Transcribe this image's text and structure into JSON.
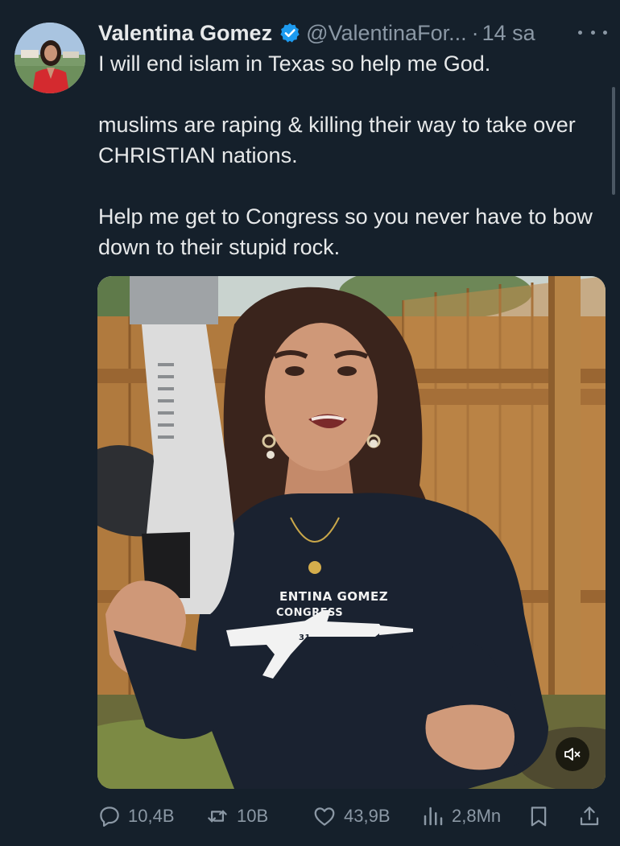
{
  "tweet": {
    "author": {
      "display_name": "Valentina Gomez",
      "handle": "@ValentinaFor...",
      "verified": true
    },
    "separator": "·",
    "timestamp": "14 sa",
    "text": {
      "line1": "I will end islam in Texas so help me God.",
      "paragraph2": "muslims are raping & killing their way to take over CHRISTIAN nations.",
      "paragraph3": "Help me get to Congress so you never have to bow down to their stupid rock."
    },
    "media": {
      "type": "video",
      "shirt_line1": "ENTINA GOMEZ",
      "shirt_line2": "CONGRESS",
      "shirt_number": "31",
      "muted": true
    },
    "stats": {
      "replies": "10,4B",
      "reposts": "10B",
      "likes": "43,9B",
      "views": "2,8Mn"
    }
  },
  "icons": {
    "more": "more-horizontal-icon",
    "verified": "verified-badge-icon",
    "reply": "reply-icon",
    "repost": "repost-icon",
    "like": "heart-icon",
    "views": "views-chart-icon",
    "bookmark": "bookmark-icon",
    "share": "share-icon",
    "mute": "volume-muted-icon"
  },
  "colors": {
    "background": "#15202b",
    "text_primary": "#e7e9ea",
    "text_secondary": "#8b98a5",
    "verified_blue": "#1d9bf0"
  }
}
